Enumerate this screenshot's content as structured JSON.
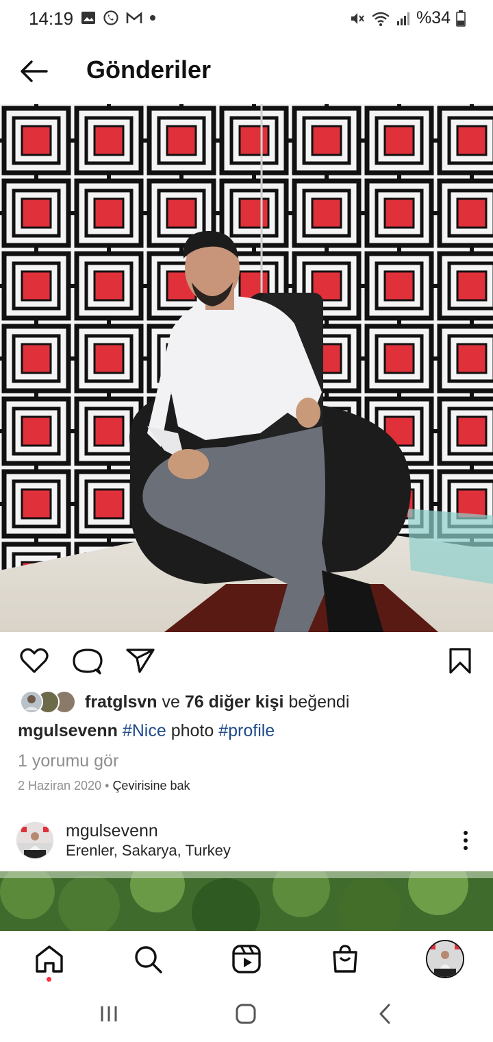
{
  "status_bar": {
    "time": "14:19",
    "battery": "%34"
  },
  "header": {
    "title": "Gönderiler"
  },
  "post": {
    "likes": {
      "liker": "fratglsvn",
      "connector": "ve",
      "others": "76 diğer kişi",
      "suffix": "beğendi"
    },
    "caption": {
      "username": "mgulsevenn",
      "tag1": "#Nice",
      "text": "photo",
      "tag2": "#profile"
    },
    "comments_link": "1 yorumu gör",
    "date": "2 Haziran 2020",
    "separator": "•",
    "translate_link": "Çevirisine bak"
  },
  "next_post": {
    "username": "mgulsevenn",
    "location": "Erenler, Sakarya, Turkey"
  },
  "colors": {
    "hashtag": "#1e4a8a",
    "notification_dot": "#ff3040",
    "wall_red": "#e0303a"
  },
  "icons": {
    "back": "arrow-left-icon",
    "like": "heart-icon",
    "comment": "comment-icon",
    "share": "paper-plane-icon",
    "save": "bookmark-icon",
    "more": "more-vertical-icon",
    "home": "home-icon",
    "search": "search-icon",
    "reels": "reels-icon",
    "shop": "shop-icon"
  }
}
